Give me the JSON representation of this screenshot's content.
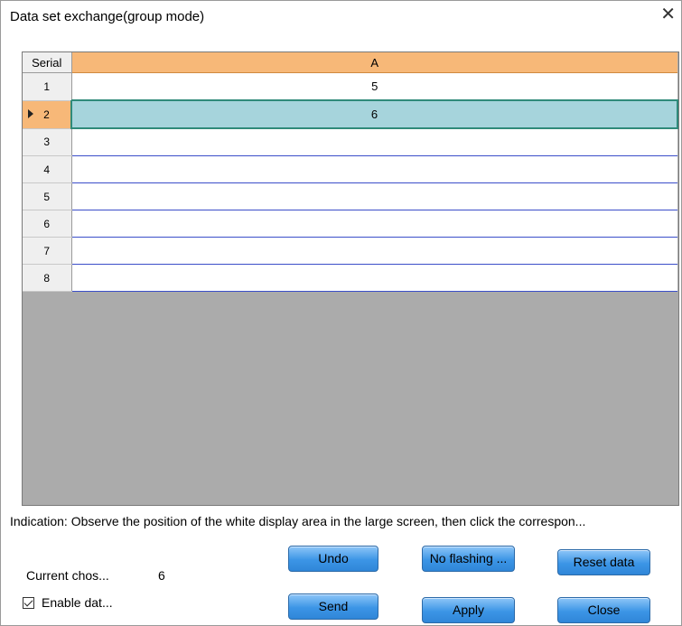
{
  "window": {
    "title": "Data set exchange(group mode)",
    "close_glyph": "✕"
  },
  "grid": {
    "header_serial": "Serial",
    "header_col_a": "A",
    "rows": [
      {
        "serial": "1",
        "a": "5"
      },
      {
        "serial": "2",
        "a": "6"
      },
      {
        "serial": "3",
        "a": ""
      },
      {
        "serial": "4",
        "a": ""
      },
      {
        "serial": "5",
        "a": ""
      },
      {
        "serial": "6",
        "a": ""
      },
      {
        "serial": "7",
        "a": ""
      },
      {
        "serial": "8",
        "a": ""
      }
    ],
    "selected_row": "2"
  },
  "indication": "Indication: Observe the position of the white display area in the large screen, then click the correspon...",
  "status": {
    "current_label": "Current chos...",
    "current_value": "6",
    "enable_label": "Enable dat...",
    "enable_checked": true
  },
  "buttons": {
    "undo": "Undo",
    "no_flashing": "No flashing ...",
    "reset_data": "Reset data",
    "send": "Send",
    "apply": "Apply",
    "close": "Close"
  },
  "colors": {
    "header_accent": "#f7b878",
    "selected_cell": "#a6d4dc",
    "button_blue": "#3c95e6"
  }
}
